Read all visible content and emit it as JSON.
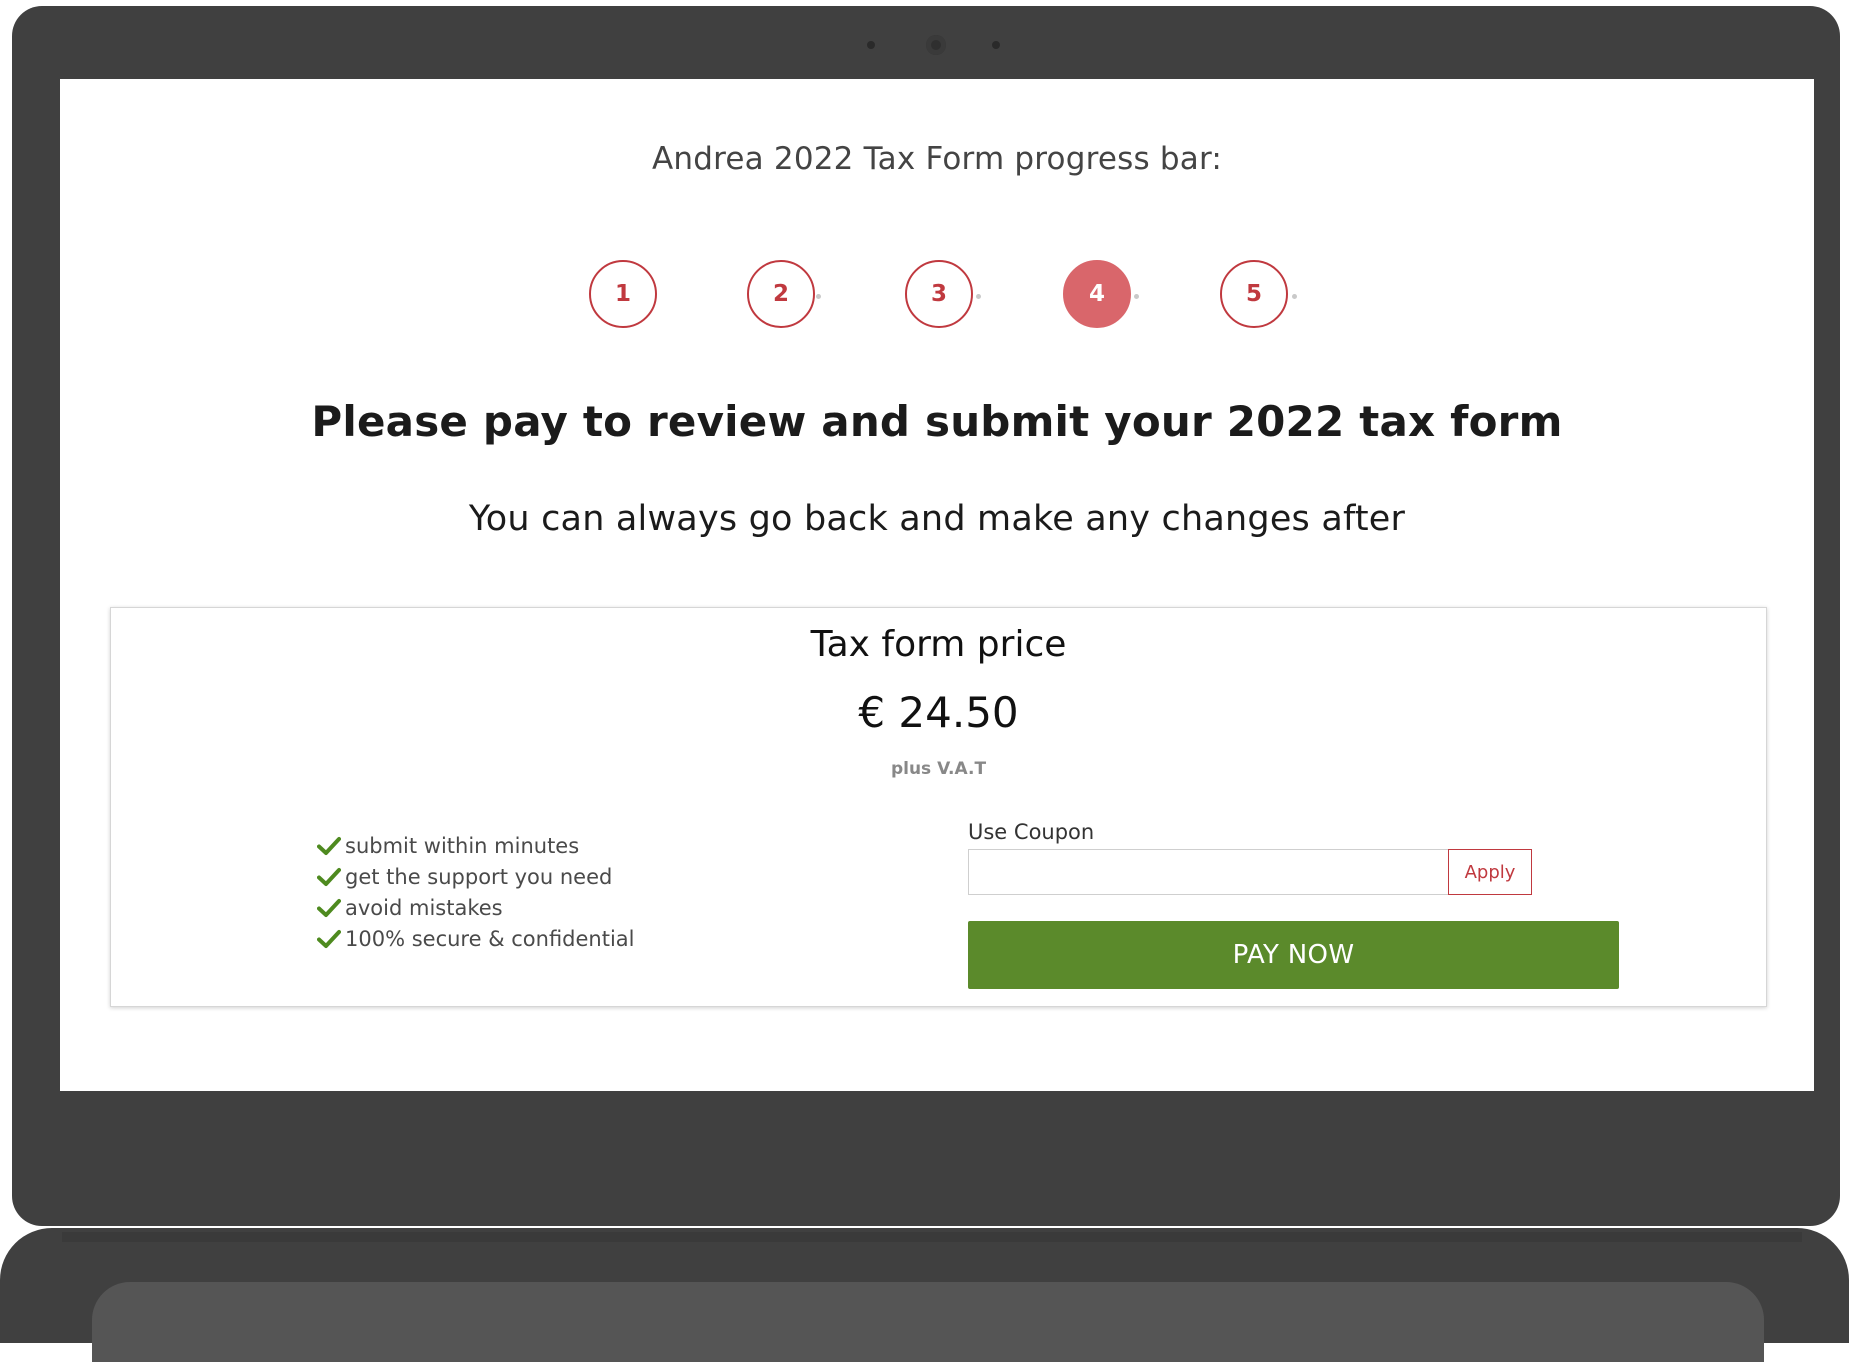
{
  "progress": {
    "title": "Andrea 2022 Tax Form progress bar:",
    "steps": [
      {
        "label": "1",
        "active": false
      },
      {
        "label": "2",
        "active": false
      },
      {
        "label": "3",
        "active": false
      },
      {
        "label": "4",
        "active": true
      },
      {
        "label": "5",
        "active": false
      }
    ],
    "current_step": 4
  },
  "headline": "Please pay to review and submit your 2022 tax form",
  "subheadline": "You can always go back and make any changes after",
  "price_card": {
    "title": "Tax form price",
    "price": "€ 24.50",
    "vat_note": "plus V.A.T",
    "benefits": [
      "submit within minutes",
      "get the support you need",
      "avoid mistakes",
      "100% secure & confidential"
    ],
    "coupon": {
      "label": "Use Coupon",
      "value": "",
      "placeholder": "",
      "apply_label": "Apply"
    },
    "pay_label": "PAY NOW"
  },
  "colors": {
    "accent_red": "#c0393f",
    "active_step": "#d9666b",
    "pay_green": "#5b8a2b",
    "check_green": "#4e8a1f",
    "device_frame": "#404040"
  },
  "icons": {
    "benefit": "checkmark-icon",
    "camera": "webcam-icon"
  }
}
